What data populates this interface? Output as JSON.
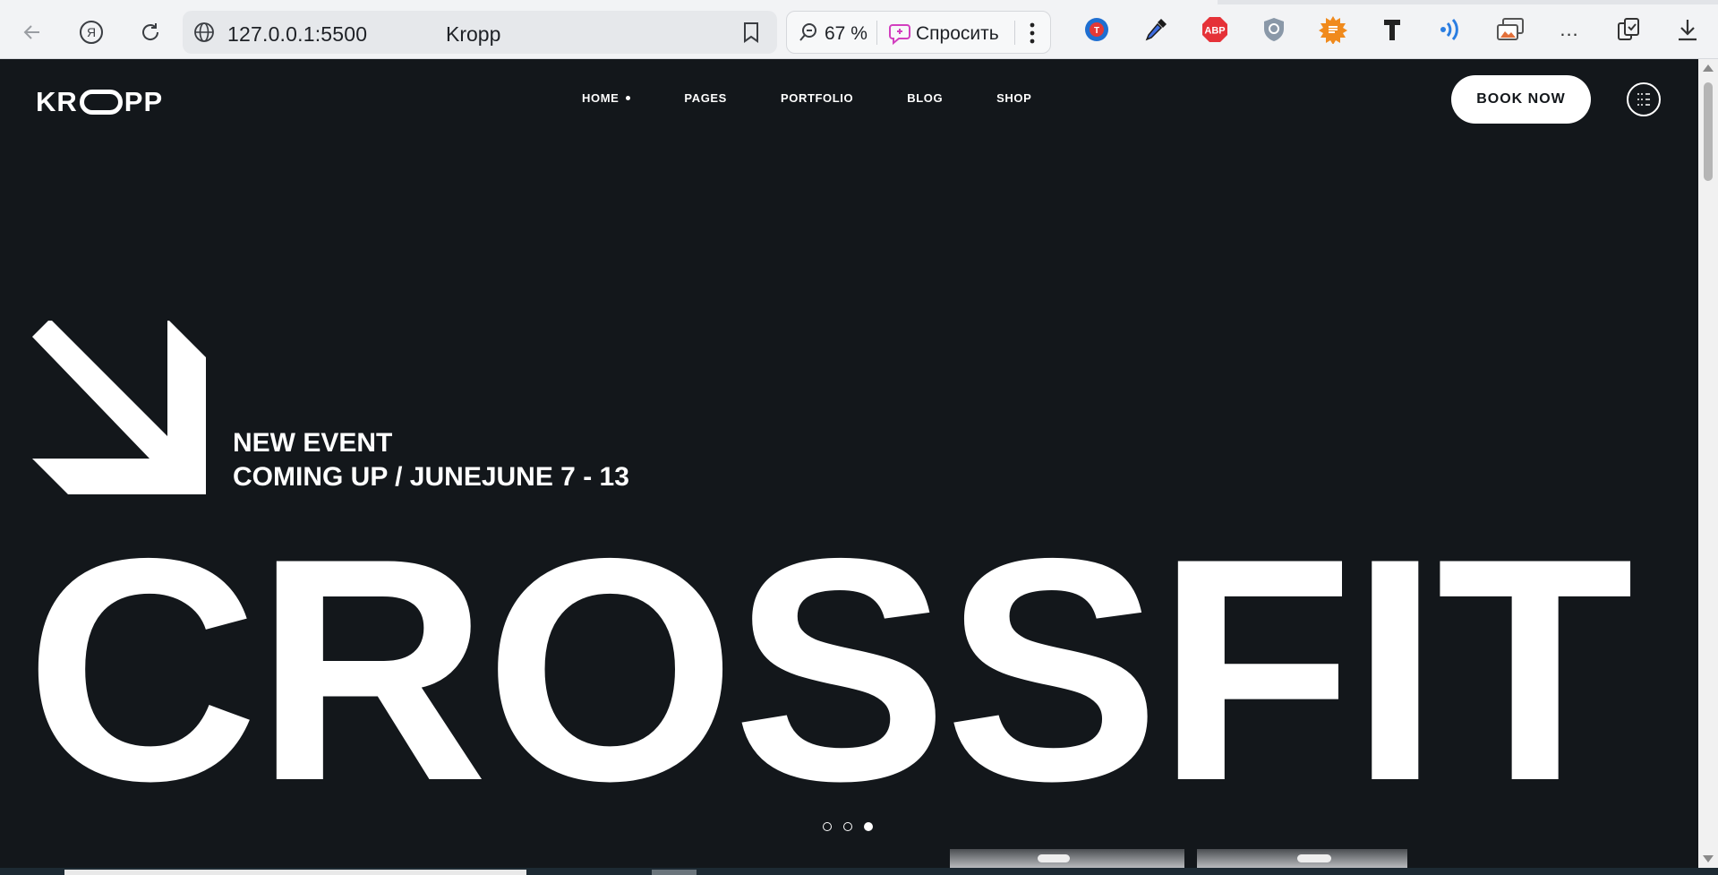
{
  "browser": {
    "url": "127.0.0.1:5500",
    "page_title": "Kropp",
    "zoom": "67 %",
    "ask_label": "Спросить",
    "ext_overflow": "...",
    "extensions": [
      "translate-icon",
      "eyedropper-icon",
      "adblock-icon",
      "shield-icon",
      "sun-icon",
      "t-icon",
      "wifi-icon",
      "screenshot-icon"
    ],
    "adblock_text": "ABP"
  },
  "site": {
    "logo": {
      "left": "KR",
      "right": "PP"
    },
    "menu": [
      {
        "label": "HOME",
        "active": true
      },
      {
        "label": "PAGES"
      },
      {
        "label": "PORTFOLIO"
      },
      {
        "label": "BLOG"
      },
      {
        "label": "SHOP"
      }
    ],
    "book_now": "BOOK NOW",
    "event_line1": "NEW EVENT",
    "event_line2": "COMING UP / JUNEJUNE 7 - 13",
    "hero": "CROSSFIT",
    "slider": {
      "count": 3,
      "active": 3
    }
  },
  "colors": {
    "page_bg": "#13171b",
    "text": "#ffffff",
    "chrome_bg": "#f2f3f5"
  }
}
